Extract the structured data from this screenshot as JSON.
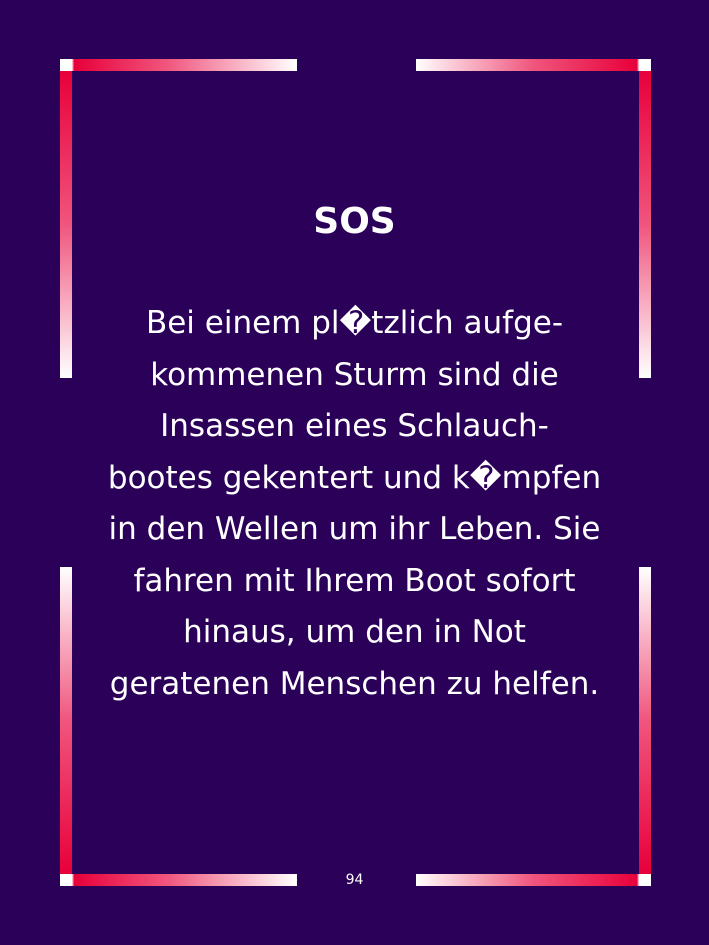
{
  "card": {
    "title": "SOS",
    "lines": [
      "Bei einem pl�tzlich aufge-",
      "kommenen Sturm sind die",
      "Insassen eines Schlauch-",
      "bootes gekentert und k�mpfen",
      "in den Wellen um ihr Leben. Sie",
      "fahren mit Ihrem Boot sofort",
      "hinaus, um den in Not",
      "geratenen Menschen zu helfen."
    ],
    "page_number": "94"
  },
  "colors": {
    "background": "#2b0059",
    "frame_red": "#e8003a",
    "frame_white": "#ffffff",
    "text": "#ffffff"
  }
}
